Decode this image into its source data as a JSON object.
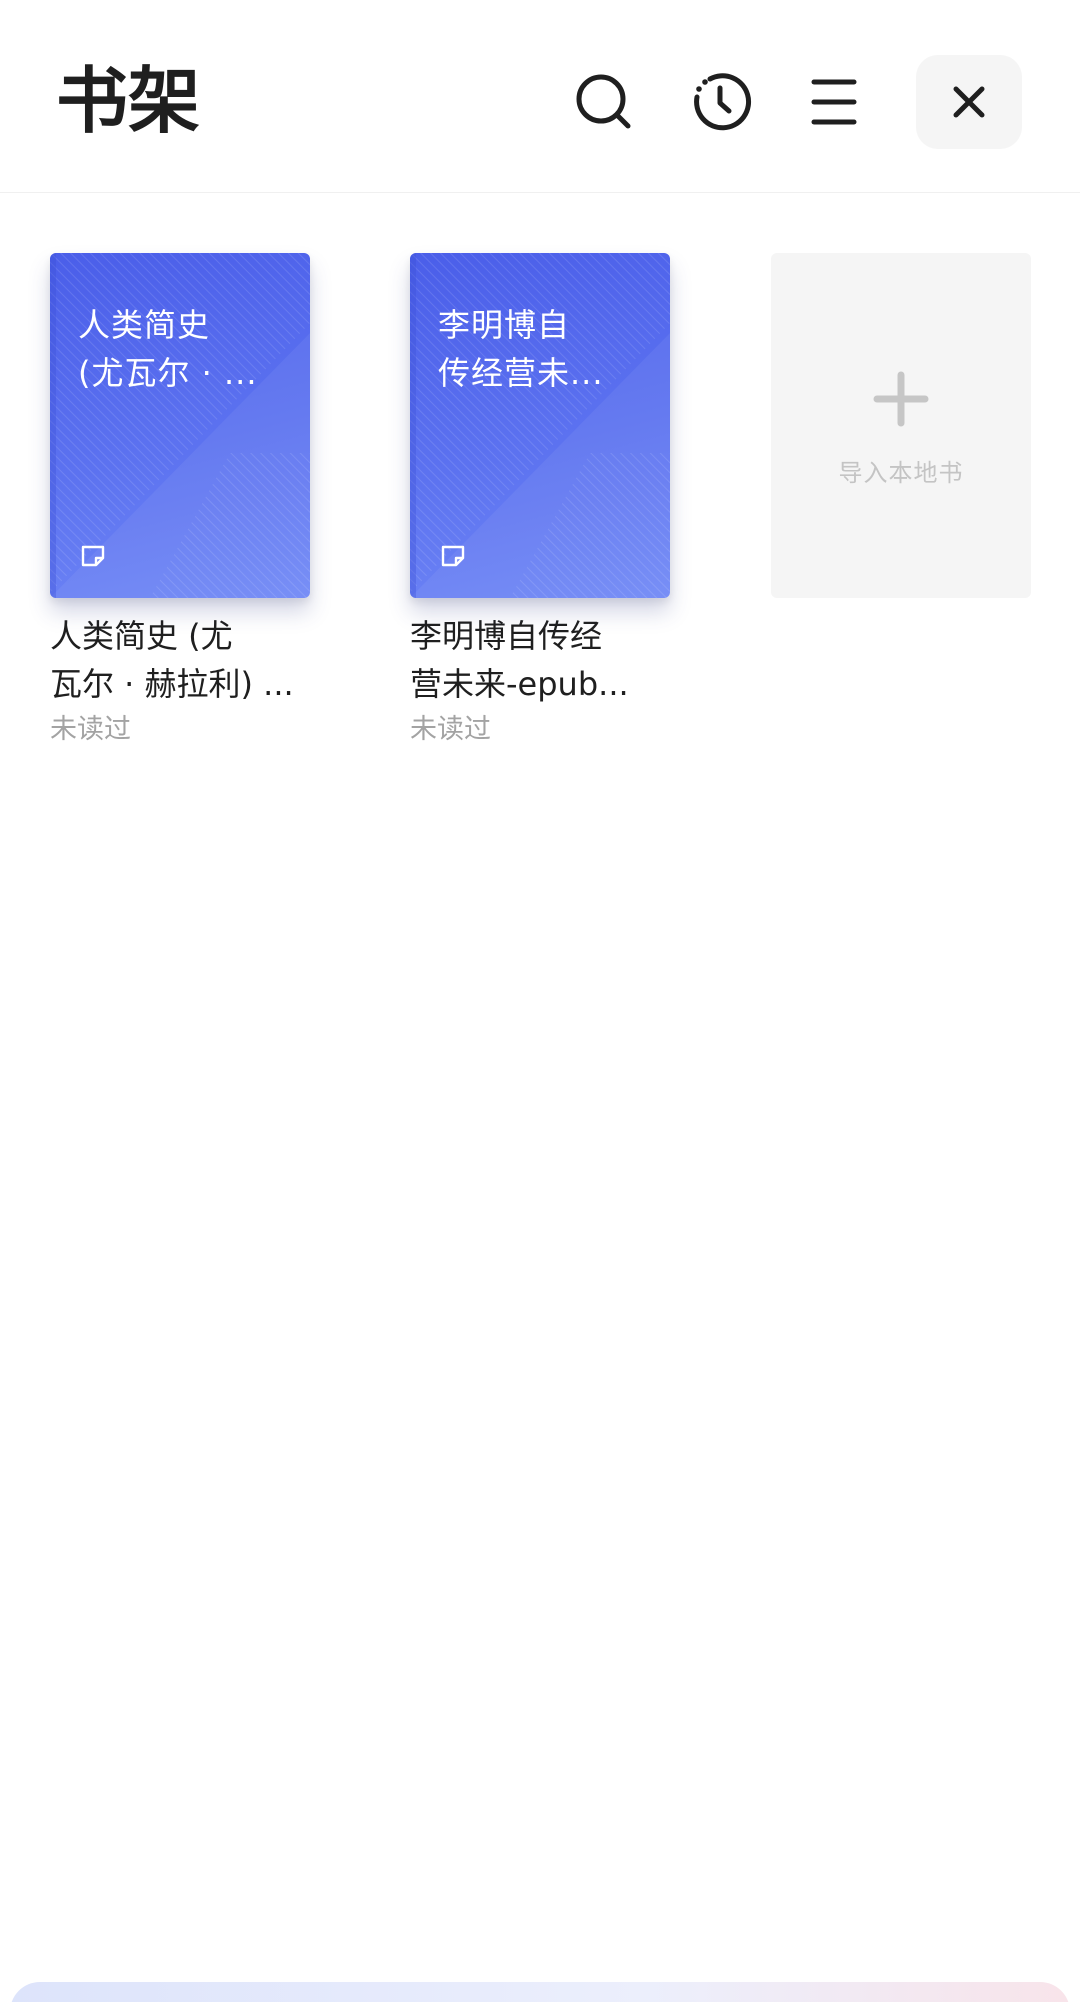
{
  "header": {
    "title": "书架",
    "icons": [
      "search-icon",
      "history-icon",
      "menu-icon",
      "close-icon"
    ]
  },
  "books": [
    {
      "cover_lines": [
        "人类简史",
        "(尤瓦尔 · ..."
      ],
      "name_lines": [
        "人类简史 (尤",
        "瓦尔 · 赫拉利) ..."
      ],
      "status": "未读过"
    },
    {
      "cover_lines": [
        "李明博自",
        "传经营未..."
      ],
      "name_lines": [
        "李明博自传经",
        "营未来-epub..."
      ],
      "status": "未读过"
    }
  ],
  "import": {
    "label": "导入本地书"
  },
  "colors": {
    "cover_blue": "#5468ee",
    "title_text": "#1f1f1f",
    "muted_text": "#a3a3a3",
    "placeholder_bg": "#f5f5f5"
  }
}
